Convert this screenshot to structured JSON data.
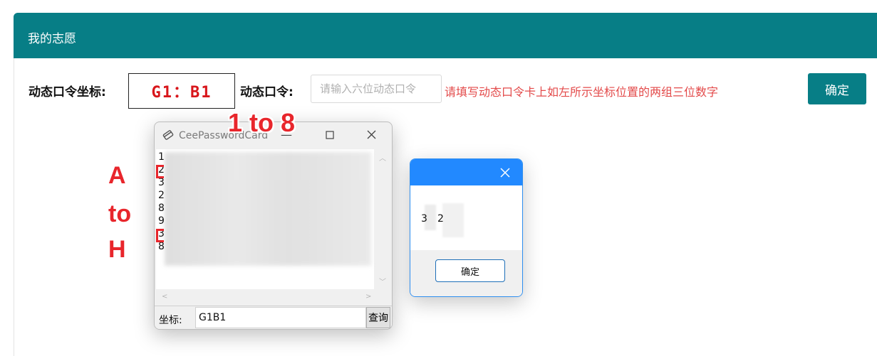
{
  "panel": {
    "title": "我的志愿"
  },
  "form": {
    "coord_label": "动态口令坐标:",
    "coord_value": "G1：B1",
    "password_label": "动态口令:",
    "password_placeholder": "请输入六位动态口令",
    "hint": "请填写动态口令卡上如左所示坐标位置的两组三位数字",
    "confirm_label": "确定"
  },
  "annotations": {
    "columns": "1 to 8",
    "rows_a": "A",
    "rows_to": "to",
    "rows_h": "H"
  },
  "card_window": {
    "title": "CeePasswordCard",
    "lines": [
      "1",
      "2",
      "3",
      "2",
      "8",
      "9",
      "3",
      "8"
    ],
    "coord_label": "坐标:",
    "coord_value": "G1B1",
    "query_label": "查询"
  },
  "message_box": {
    "digit1": "3",
    "digit2": "2",
    "ok_label": "确定"
  },
  "colors": {
    "header": "#077e86",
    "hint": "#e34a4a",
    "annotation": "#e8262c",
    "msg_header": "#2289ff"
  },
  "icons": {
    "card_icon": "card-icon",
    "close": "close-icon",
    "minimize": "minimize-icon",
    "maximize": "maximize-icon"
  }
}
